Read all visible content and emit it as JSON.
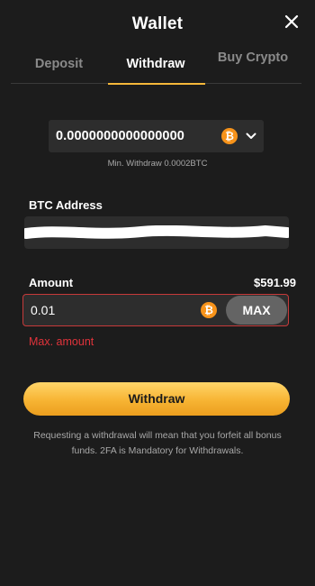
{
  "header": {
    "title": "Wallet"
  },
  "tabs": [
    {
      "label": "Deposit"
    },
    {
      "label": "Withdraw"
    },
    {
      "label": "Buy Crypto"
    }
  ],
  "active_tab": "Withdraw",
  "currency_select": {
    "value": "0.0000000000000000",
    "currency_icon": "btc-icon"
  },
  "min_withdraw_note": "Min. Withdraw 0.0002BTC",
  "address": {
    "label": "BTC Address",
    "value": ""
  },
  "amount": {
    "label": "Amount",
    "balance": "$591.99",
    "value": "0.01",
    "max_label": "MAX",
    "error": "Max. amount"
  },
  "withdraw_button_label": "Withdraw",
  "notice": "Requesting a withdrawal will mean that you forfeit all bonus funds. 2FA is Mandatory for Withdrawals.",
  "colors": {
    "background": "#1c1c1c",
    "accent": "#f5b73a",
    "error": "#e0333b",
    "bitcoin": "#f7931a"
  }
}
